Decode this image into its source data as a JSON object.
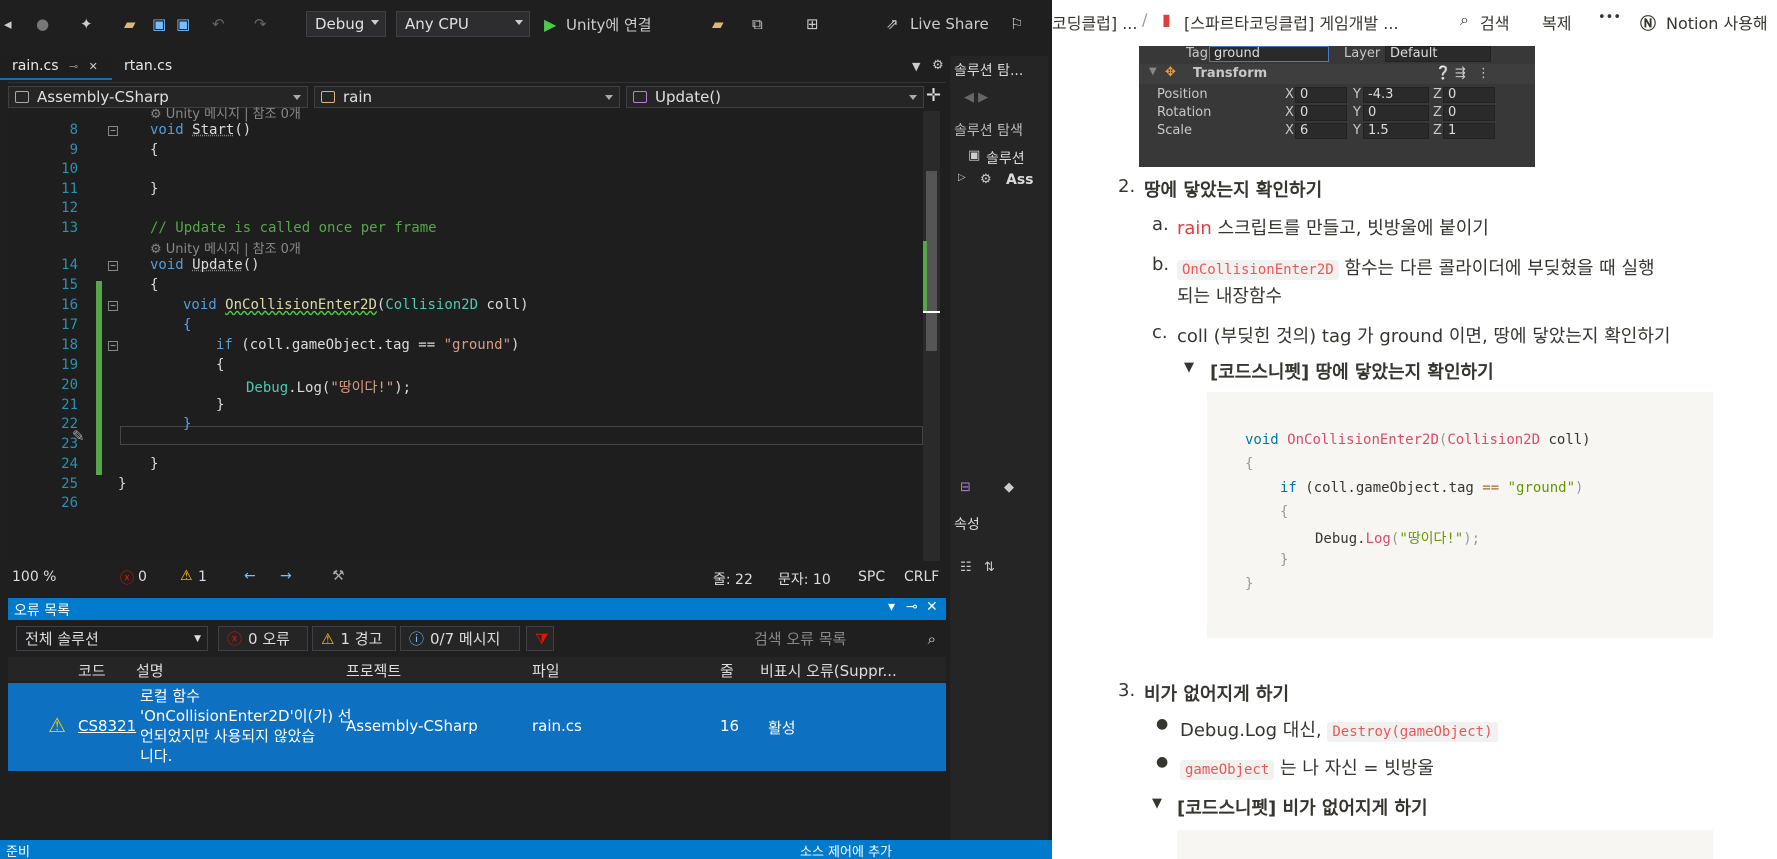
{
  "vs": {
    "toolbar": {
      "config": "Debug",
      "platform": "Any CPU",
      "run_label": "Unity에 연결",
      "live_share": "Live Share"
    },
    "tabs": [
      {
        "label": "rain.cs",
        "pin": "⊸",
        "close": "✕"
      },
      {
        "label": "rtan.cs"
      }
    ],
    "nav": {
      "project": "Assembly-CSharp",
      "class": "rain",
      "member": "Update()"
    },
    "code": {
      "lines": [
        "8",
        "9",
        "10",
        "11",
        "12",
        "13",
        "14",
        "15",
        "16",
        "17",
        "18",
        "19",
        "20",
        "21",
        "22",
        "23",
        "24",
        "25",
        "26"
      ],
      "hint1": "Unity 메시지 | 참조 0개",
      "hint2": "Unity 메시지 | 참조 0개",
      "start_kw": "void",
      "start_name": "Start",
      "start_paren": "()",
      "open1": "{",
      "close1": "}",
      "comment": "// Update is called once per frame",
      "update_kw": "void",
      "update_name": "Update",
      "update_paren": "()",
      "open2": "{",
      "oce_kw": "void",
      "oce_name": "OnCollisionEnter2D",
      "oce_open": "(",
      "oce_type": "Collision2D",
      "oce_param": " coll)",
      "open3": "{",
      "if_kw": "if",
      "if_cond": " (coll.gameObject.tag == ",
      "if_str": "\"ground\"",
      "if_close": ")",
      "open4": "{",
      "debug": "Debug",
      "log": ".Log(",
      "log_str": "\"땅이다!\"",
      "log_end": ");",
      "close4": "}",
      "close3": "}",
      "close2": "}",
      "close_class": "}"
    },
    "status": {
      "zoom": "100 %",
      "errors": "0",
      "warnings": "1",
      "line": "줄: 22",
      "char": "문자: 10",
      "spc": "SPC",
      "crlf": "CRLF"
    },
    "error_list": {
      "title": "오류 목록",
      "scope": "전체 솔루션",
      "errors_btn": "0 오류",
      "warnings_btn": "1 경고",
      "messages_btn": "0/7 메시지",
      "search_placeholder": "검색 오류 목록",
      "columns": [
        "코드",
        "설명",
        "프로젝트",
        "파일",
        "줄",
        "비표시 오류(Suppr..."
      ],
      "row": {
        "code": "CS8321",
        "desc1": "로컬 함수",
        "desc2": "'OnCollisionEnter2D'이(가) 선",
        "desc3": "언되었지만 사용되지 않았습",
        "desc4": "니다.",
        "project": "Assembly-CSharp",
        "file": "rain.cs",
        "line": "16",
        "state": "활성"
      }
    },
    "solution": {
      "title": "솔루션 탐...",
      "title2": "솔루션 탐색",
      "item1": "솔루션",
      "item2": "Ass",
      "props": "속성"
    },
    "bottom": {
      "left": "준비",
      "right": "소스 제어에 추가"
    }
  },
  "notion": {
    "breadcrumb1": "코딩클럽] ...",
    "sep": "/",
    "breadcrumb2": "[스파르타코딩클럽] 게임개발 ...",
    "search": "검색",
    "duplicate": "복제",
    "more": "•••",
    "notion_use": "Notion 사용해",
    "unity": {
      "tag_label": "Tag",
      "tag_value": "ground",
      "layer_label": "Layer",
      "layer_value": "Default",
      "transform": "Transform",
      "rows": [
        {
          "label": "Position",
          "x": "0",
          "y": "-4.3",
          "z": "0"
        },
        {
          "label": "Rotation",
          "x": "0",
          "y": "0",
          "z": "0"
        },
        {
          "label": "Scale",
          "x": "6",
          "y": "1.5",
          "z": "1"
        }
      ]
    },
    "step2_num": "2.",
    "step2": "땅에 닿았는지 확인하기",
    "a_num": "a.",
    "a_red": "rain",
    "a_text": " 스크립트를 만들고, 빗방울에 붙이기",
    "b_num": "b.",
    "b_code": "OnCollisionEnter2D",
    "b_text1": " 함수는 다른 콜라이더에 부딪혔을 때 실행",
    "b_text2": "되는 내장함수",
    "c_num": "c.",
    "c_text": "coll (부딪힌 것의) tag 가 ground 이면, 땅에 닿았는지 확인하기",
    "toggle1": "[코드스니펫] 땅에 닿았는지 확인하기",
    "snippet": {
      "void": "void",
      "fn": "OnCollisionEnter2D",
      "p1": "(",
      "type": "Collision2D",
      "param": " coll)",
      "open": "{",
      "if": "if",
      "cond1": " (coll.gameObject.tag ",
      "eq": "==",
      "str": "\"ground\"",
      "cond2": ")",
      "open2": "{",
      "dbg": "Debug.",
      "log": "Log",
      "lp": "(",
      "logstr": "\"땅이다!\"",
      "end": ");",
      "close2": "}",
      "close": "}"
    },
    "step3_num": "3.",
    "step3": "비가 없어지게 하기",
    "bullet1_pre": "Debug.Log 대신, ",
    "bullet1_code": "Destroy(gameObject)",
    "bullet2_code": "gameObject",
    "bullet2_text": " 는 나 자신 = 빗방울",
    "toggle2": "[코드스니펫] 비가 없어지게 하기"
  }
}
